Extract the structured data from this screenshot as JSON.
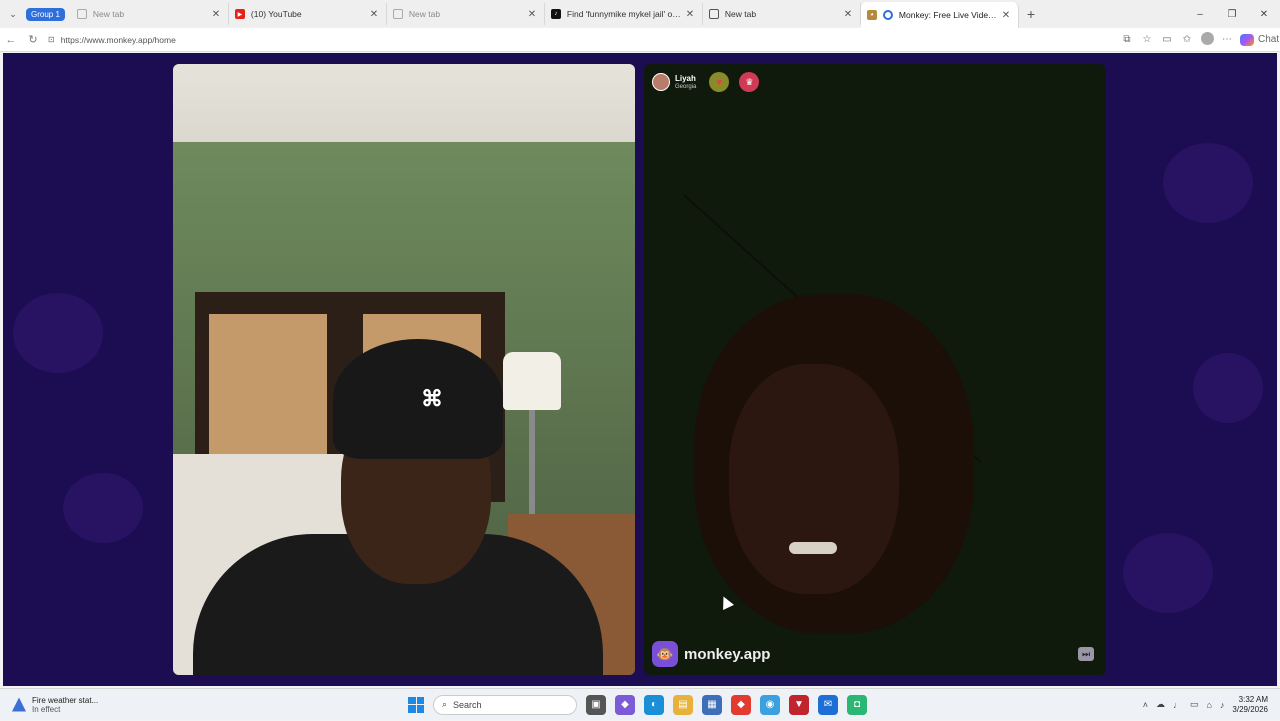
{
  "browser": {
    "group_label": "Group 1",
    "tabs": [
      {
        "title": "New tab",
        "favicon": "doc-icon",
        "state": "muted"
      },
      {
        "title": "(10) YouTube",
        "favicon": "youtube-icon",
        "state": "normal"
      },
      {
        "title": "New tab",
        "favicon": "doc-icon",
        "state": "muted"
      },
      {
        "title": "Find 'funnymike mykel jail' on TikT",
        "favicon": "tiktok-icon",
        "state": "normal"
      },
      {
        "title": "New tab",
        "favicon": "doc-icon",
        "state": "normal"
      },
      {
        "title": "Monkey: Free Live Video Chat",
        "favicon": "monkey-icon",
        "state": "active"
      }
    ],
    "url": "https://www.monkey.app/home",
    "copilot_label": "Chat"
  },
  "call": {
    "remote_user": {
      "name": "Liyah",
      "location": "Georgia"
    },
    "brand": "monkey.app"
  },
  "taskbar": {
    "weather_title": "Fire weather stat...",
    "weather_sub": "In effect",
    "search_placeholder": "Search",
    "time": "3:32 AM",
    "date": "3/29/2026"
  },
  "colors": {
    "background": "#1c0c52",
    "accent": "#2f6fdb",
    "brand": "#7a4fd8"
  }
}
